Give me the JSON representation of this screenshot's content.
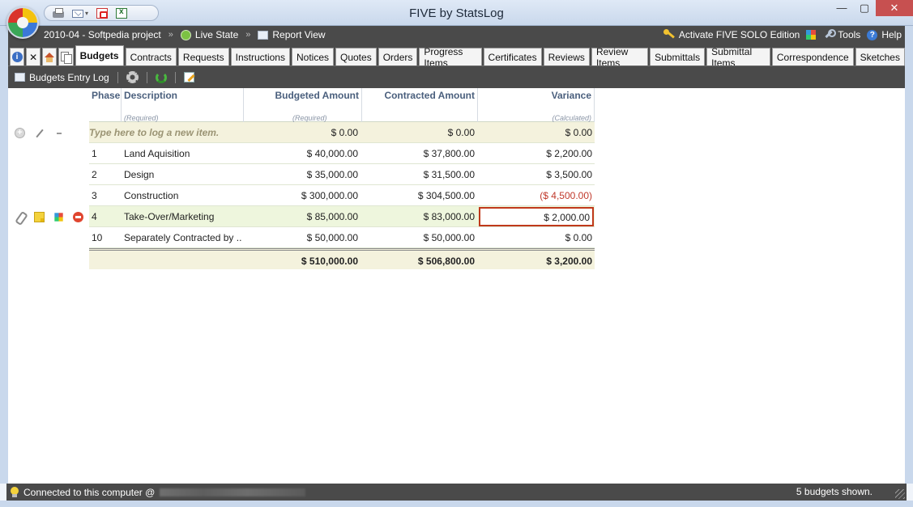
{
  "window": {
    "title": "FIVE by StatsLog",
    "minimize": "—",
    "maximize": "▢",
    "close": "✕"
  },
  "projectbar": {
    "project": "2010-04 - Softpedia project",
    "sep1": "»",
    "live_state": "Live State",
    "sep2": "»",
    "report_view": "Report View",
    "activate": "Activate FIVE SOLO Edition",
    "tools": "Tools",
    "help": "Help"
  },
  "tabs": {
    "info": "i",
    "close": "✕",
    "items": [
      {
        "label": "Budgets"
      },
      {
        "label": "Contracts"
      },
      {
        "label": "Requests"
      },
      {
        "label": "Instructions"
      },
      {
        "label": "Notices"
      },
      {
        "label": "Quotes"
      },
      {
        "label": "Orders"
      },
      {
        "label": "Progress Items"
      },
      {
        "label": "Certificates"
      },
      {
        "label": "Reviews"
      },
      {
        "label": "Review Items"
      },
      {
        "label": "Submittals"
      },
      {
        "label": "Submittal Items"
      },
      {
        "label": "Correspondence"
      },
      {
        "label": "Sketches"
      }
    ]
  },
  "toolbar": {
    "entry_log": "Budgets Entry Log"
  },
  "table": {
    "headers": {
      "phase": "Phase",
      "description": "Description",
      "budgeted": "Budgeted Amount",
      "contracted": "Contracted Amount",
      "variance": "Variance",
      "desc_note": "(Required)",
      "bud_note": "(Required)",
      "var_note": "(Calculated)"
    },
    "new_row": {
      "placeholder": "Type here to log a new item.",
      "budgeted": "$ 0.00",
      "contracted": "$ 0.00",
      "variance": "$ 0.00"
    },
    "rows": [
      {
        "phase": "1",
        "description": "Land Aquisition",
        "budgeted": "$ 40,000.00",
        "contracted": "$ 37,800.00",
        "variance": "$ 2,200.00"
      },
      {
        "phase": "2",
        "description": "Design",
        "budgeted": "$ 35,000.00",
        "contracted": "$ 31,500.00",
        "variance": "$ 3,500.00"
      },
      {
        "phase": "3",
        "description": "Construction",
        "budgeted": "$ 300,000.00",
        "contracted": "$ 304,500.00",
        "variance": "($ 4,500.00)"
      },
      {
        "phase": "4",
        "description": "Take-Over/Marketing",
        "budgeted": "$ 85,000.00",
        "contracted": "$ 83,000.00",
        "variance": "$ 2,000.00"
      },
      {
        "phase": "10",
        "description": "Separately Contracted by ...",
        "budgeted": "$ 50,000.00",
        "contracted": "$ 50,000.00",
        "variance": "$ 0.00"
      }
    ],
    "totals": {
      "budgeted": "$ 510,000.00",
      "contracted": "$ 506,800.00",
      "variance": "$ 3,200.00"
    }
  },
  "status": {
    "connected": "Connected to this computer @",
    "count": "5 budgets shown."
  },
  "colors": {
    "dark_bar": "#4a4a4a",
    "negative": "#c0392b",
    "row_highlight": "#eef6dd",
    "new_row": "#f4f2dd"
  }
}
